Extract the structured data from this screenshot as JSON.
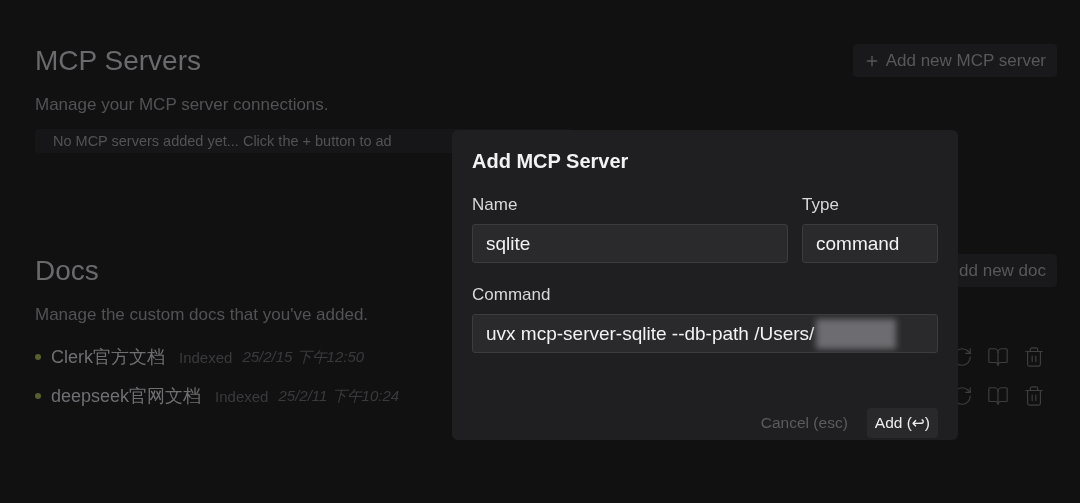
{
  "mcp_servers": {
    "title": "MCP Servers",
    "description": "Manage your MCP server connections.",
    "add_button": {
      "label": "Add new MCP server"
    },
    "empty_message": "No MCP servers added yet... Click the + button to ad"
  },
  "docs": {
    "title": "Docs",
    "description": "Manage the custom docs that you've added.",
    "add_button": {
      "label": "dd new doc"
    },
    "items": [
      {
        "name": "Clerk官方文档",
        "status": "Indexed",
        "date": "25/2/15 下午12:50"
      },
      {
        "name": "deepseek官网文档",
        "status": "Indexed",
        "date": "25/2/11 下午10:24"
      }
    ]
  },
  "dialog": {
    "title": "Add MCP Server",
    "name_field": {
      "label": "Name",
      "value": "sqlite"
    },
    "type_field": {
      "label": "Type",
      "value": "command"
    },
    "command_field": {
      "label": "Command",
      "value": "uvx mcp-server-sqlite --db-path /Users/"
    },
    "cancel_button": {
      "label": "Cancel (esc)"
    },
    "add_button": {
      "label": "Add (↩)"
    }
  }
}
